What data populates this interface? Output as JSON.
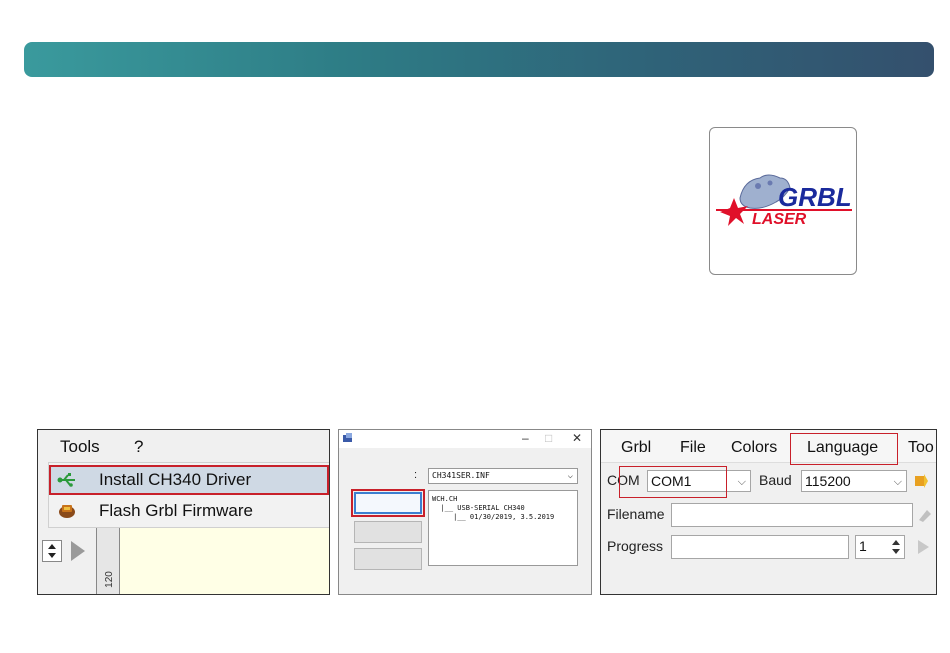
{
  "logo": {
    "line1": "GRBL",
    "line2": "LASER",
    "brand_blue": "#1a2a9c",
    "brand_red": "#e0102a"
  },
  "shot1": {
    "menu": [
      "Tools",
      "?"
    ],
    "items": [
      {
        "label": "Install CH340 Driver",
        "icon": "usb-icon",
        "highlighted": true
      },
      {
        "label": "Flash Grbl Firmware",
        "icon": "chip-icon",
        "highlighted": false
      }
    ],
    "ruler_label": "120"
  },
  "shot2": {
    "window_controls": [
      "–",
      "□",
      "✕"
    ],
    "colon": ":",
    "inf_select": "CH341SER.INF",
    "info_lines": [
      "WCH.CH",
      "  |__ USB-SERIAL CH340",
      "     |__ 01/30/2019, 3.5.2019"
    ]
  },
  "shot3": {
    "menu": [
      "Grbl",
      "File",
      "Colors",
      "Language",
      "Too"
    ],
    "com_label": "COM",
    "com_value": "COM1",
    "baud_label": "Baud",
    "baud_value": "115200",
    "filename_label": "Filename",
    "progress_label": "Progress",
    "progress_value": "1"
  },
  "colors": {
    "highlight_red": "#c8202a",
    "header_start": "#3a9a9d",
    "header_end": "#34506d"
  }
}
